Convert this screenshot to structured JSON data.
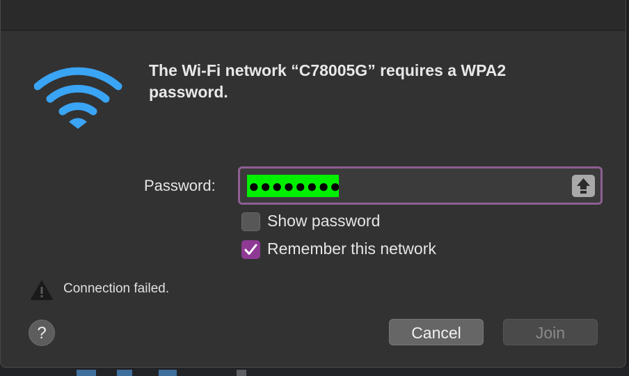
{
  "dialog": {
    "heading": "The Wi-Fi network “C78005G” requires a WPA2 password.",
    "wifi_icon": "wifi-icon",
    "accent_color": "#8e3a95",
    "wifi_color": "#3aa4f5"
  },
  "password": {
    "label": "Password:",
    "value": "●●●●●●●●",
    "highlight_color": "#00f000",
    "caps_icon": "capslock-icon"
  },
  "options": {
    "show_password": {
      "label": "Show password",
      "checked": false
    },
    "remember_network": {
      "label": "Remember this network",
      "checked": true
    }
  },
  "status": {
    "icon": "warning-icon",
    "text": "Connection failed."
  },
  "buttons": {
    "help": "?",
    "cancel": "Cancel",
    "join": "Join",
    "join_enabled": false
  }
}
